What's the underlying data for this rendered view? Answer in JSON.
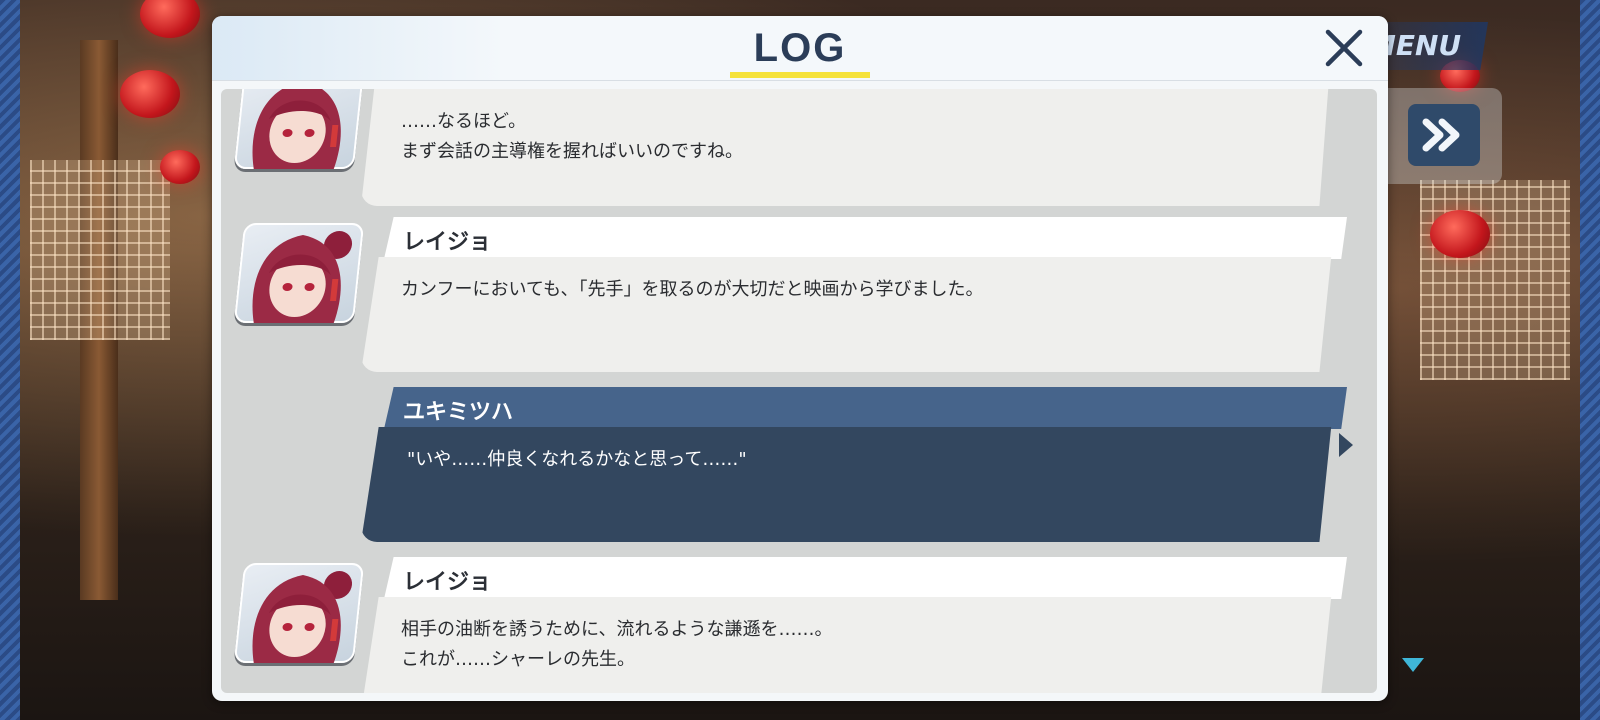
{
  "hud": {
    "menu_label": "MENU",
    "fast_forward_icon": "fast-forward-icon",
    "scroll_icon": "triangle-down-icon"
  },
  "log": {
    "title": "LOG",
    "close_icon": "close-icon",
    "accent_color": "#f5e23a",
    "entries": [
      {
        "speaker": "",
        "lines": [
          "……なるほど。",
          "まず会話の主導権を握ればいいのですね。"
        ]
      },
      {
        "speaker": "レイジョ",
        "lines": [
          "カンフーにおいても、「先手」を取るのが大切だと映画から学びました。"
        ]
      },
      {
        "speaker": "ユキミツハ",
        "lines": [
          "\"いや……仲良くなれるかなと思って……\""
        ]
      },
      {
        "speaker": "レイジョ",
        "lines": [
          "相手の油断を誘うために、流れるような謙遜を……。",
          "これが……シャーレの先生。"
        ]
      }
    ]
  },
  "colors": {
    "npc_bubble": "#efefed",
    "player_bubble": "#33475f",
    "player_nameplate": "#46648b"
  }
}
